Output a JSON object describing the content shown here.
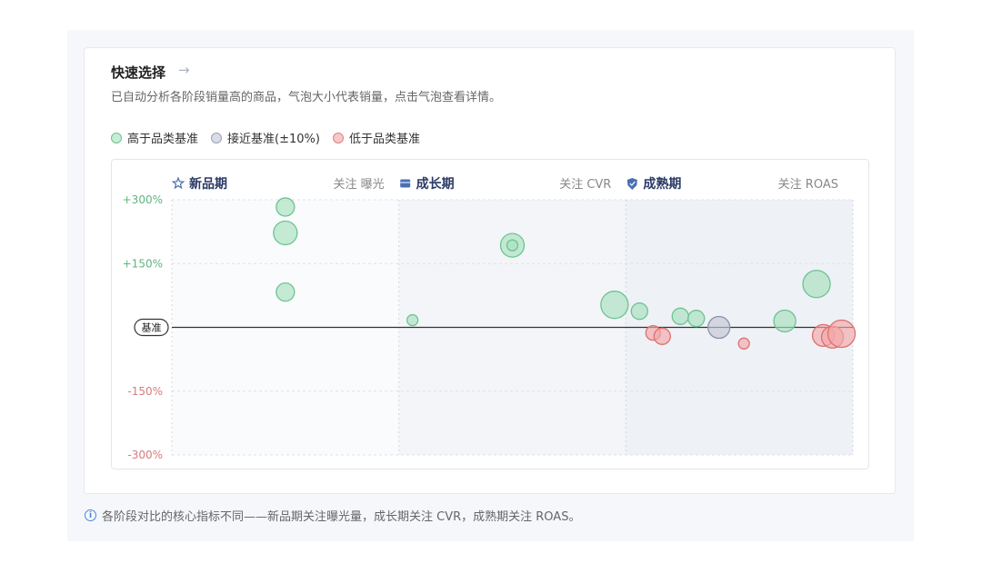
{
  "header": {
    "title": "快速选择",
    "arrow": "→",
    "description": "已自动分析各阶段销量高的商品，气泡大小代表销量，点击气泡查看详情。"
  },
  "legend": [
    {
      "label": "高于品类基准",
      "fill": "#c8ecd6",
      "stroke": "#6cc391"
    },
    {
      "label": "接近基准(±10%)",
      "fill": "#d9dce6",
      "stroke": "#9aa1b4"
    },
    {
      "label": "低于品类基准",
      "fill": "#f5c9c9",
      "stroke": "#df7f7f"
    }
  ],
  "footer": {
    "text": "各阶段对比的核心指标不同——新品期关注曝光量，成长期关注 CVR，成熟期关注 ROAS。"
  },
  "chart_data": {
    "type": "scatter",
    "baseline_label": "基准",
    "ylim": [
      -300,
      300
    ],
    "y_ticks": [
      {
        "label": "+300%",
        "value": 300
      },
      {
        "label": "+150%",
        "value": 150
      },
      {
        "label": "-150%",
        "value": -150
      },
      {
        "label": "-300%",
        "value": -300
      }
    ],
    "colors": {
      "above": {
        "fill": "#a8e0bf",
        "stroke": "#6cc391"
      },
      "near": {
        "fill": "#c4c8d6",
        "stroke": "#8c93a8"
      },
      "below": {
        "fill": "#f2a8a8",
        "stroke": "#df6f6f"
      }
    },
    "stages": [
      {
        "name": "新品期",
        "focus": "关注 曝光",
        "icon": "star-icon"
      },
      {
        "name": "成长期",
        "focus": "关注 CVR",
        "icon": "box-icon"
      },
      {
        "name": "成熟期",
        "focus": "关注 ROAS",
        "icon": "shield-icon"
      }
    ],
    "points": [
      {
        "stage": 0,
        "pos": 0.5,
        "y": 283,
        "size": 10,
        "status": "above"
      },
      {
        "stage": 0,
        "pos": 0.5,
        "y": 222,
        "size": 13,
        "status": "above"
      },
      {
        "stage": 0,
        "pos": 0.5,
        "y": 83,
        "size": 10,
        "status": "above"
      },
      {
        "stage": 1,
        "pos": 0.06,
        "y": 17,
        "size": 6,
        "status": "above"
      },
      {
        "stage": 1,
        "pos": 0.5,
        "y": 193,
        "size": 13,
        "status": "above"
      },
      {
        "stage": 1,
        "pos": 0.5,
        "y": 193,
        "size": 6,
        "status": "above"
      },
      {
        "stage": 1,
        "pos": 0.95,
        "y": 53,
        "size": 15,
        "status": "above"
      },
      {
        "stage": 2,
        "pos": 0.06,
        "y": 38,
        "size": 9,
        "status": "above"
      },
      {
        "stage": 2,
        "pos": 0.12,
        "y": -13,
        "size": 8,
        "status": "below"
      },
      {
        "stage": 2,
        "pos": 0.16,
        "y": -21,
        "size": 9,
        "status": "below"
      },
      {
        "stage": 2,
        "pos": 0.24,
        "y": 26,
        "size": 9,
        "status": "above"
      },
      {
        "stage": 2,
        "pos": 0.31,
        "y": 21,
        "size": 9,
        "status": "above"
      },
      {
        "stage": 2,
        "pos": 0.41,
        "y": 0,
        "size": 12,
        "status": "near"
      },
      {
        "stage": 2,
        "pos": 0.52,
        "y": -38,
        "size": 6,
        "status": "below"
      },
      {
        "stage": 2,
        "pos": 0.7,
        "y": 15,
        "size": 12,
        "status": "above"
      },
      {
        "stage": 2,
        "pos": 0.84,
        "y": 102,
        "size": 15,
        "status": "above"
      },
      {
        "stage": 2,
        "pos": 0.87,
        "y": -19,
        "size": 12,
        "status": "below"
      },
      {
        "stage": 2,
        "pos": 0.91,
        "y": -23,
        "size": 12,
        "status": "below"
      },
      {
        "stage": 2,
        "pos": 0.95,
        "y": -15,
        "size": 15,
        "status": "below"
      }
    ]
  }
}
